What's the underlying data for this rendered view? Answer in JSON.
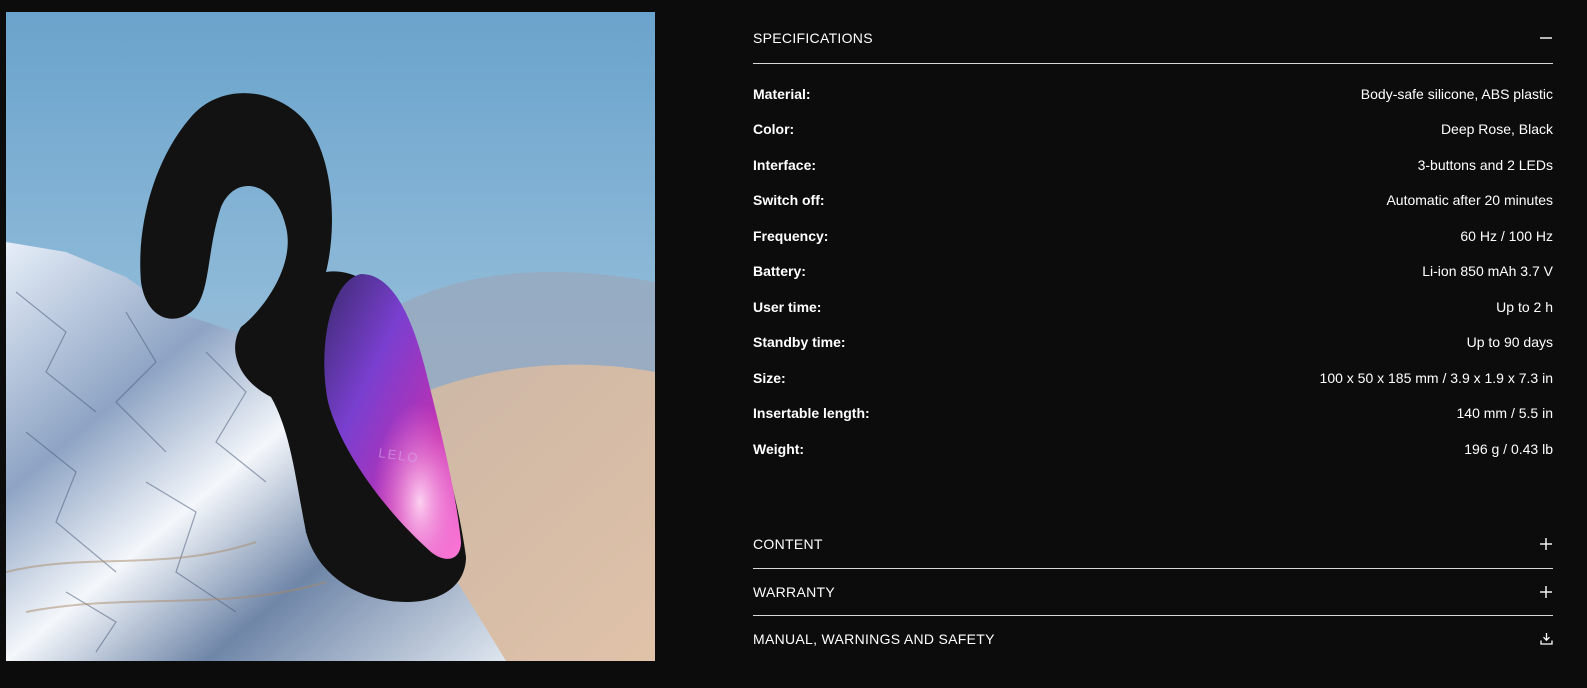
{
  "product_image": {
    "alt": "Product photo",
    "brand_mark": "LELO"
  },
  "accordion": {
    "specifications": {
      "title": "SPECIFICATIONS",
      "icon": "minus-icon",
      "rows": [
        {
          "label": "Material:",
          "value": "Body-safe silicone, ABS plastic"
        },
        {
          "label": "Color:",
          "value": "Deep Rose, Black"
        },
        {
          "label": "Interface:",
          "value": "3-buttons and 2 LEDs"
        },
        {
          "label": "Switch off:",
          "value": "Automatic after 20 minutes"
        },
        {
          "label": "Frequency:",
          "value": "60 Hz / 100 Hz"
        },
        {
          "label": "Battery:",
          "value": "Li-ion 850 mAh 3.7 V"
        },
        {
          "label": "User time:",
          "value": "Up to 2 h"
        },
        {
          "label": "Standby time:",
          "value": "Up to 90 days"
        },
        {
          "label": "Size:",
          "value": "100 x 50 x 185 mm / 3.9 x 1.9 x 7.3 in"
        },
        {
          "label": "Insertable length:",
          "value": "140 mm / 5.5 in"
        },
        {
          "label": "Weight:",
          "value": "196 g / 0.43 lb"
        }
      ]
    },
    "content": {
      "title": "CONTENT",
      "icon": "plus-icon"
    },
    "warranty": {
      "title": "WARRANTY",
      "icon": "plus-icon"
    },
    "manual": {
      "title": "MANUAL, WARNINGS AND SAFETY",
      "icon": "download-icon"
    }
  },
  "colors": {
    "background": "#0c0c0d",
    "text": "#ffffff",
    "divider": "#d9d9d9"
  }
}
